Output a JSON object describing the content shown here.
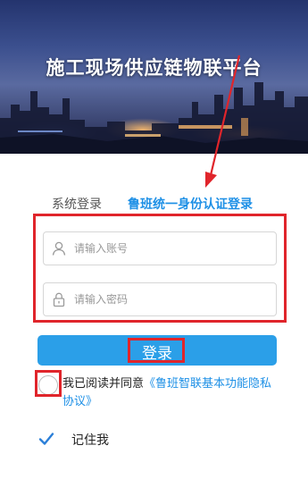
{
  "header": {
    "title": "施工现场供应链物联平台"
  },
  "tabs": [
    {
      "label": "系统登录",
      "active": false
    },
    {
      "label": "鲁班统一身份认证登录",
      "active": true
    }
  ],
  "form": {
    "account_placeholder": "请输入账号",
    "password_placeholder": "请输入密码",
    "account_icon": "user-icon",
    "password_icon": "lock-icon"
  },
  "login_button": {
    "label": "登录"
  },
  "agreement": {
    "prefix": "我已阅读并同意",
    "link_text": "《鲁班智联基本功能隐私协议》",
    "checked": false
  },
  "remember": {
    "label": "记住我",
    "checked": true
  },
  "colors": {
    "accent": "#2b9fe8",
    "link": "#1e90e6",
    "annotation": "#e0252b"
  }
}
